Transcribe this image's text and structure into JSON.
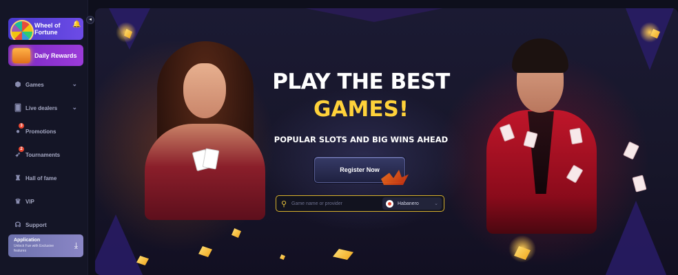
{
  "sidebar": {
    "wheel_label": "Wheel of Fortune",
    "daily_label": "Daily Rewards",
    "collapse_icon": "◂",
    "items": [
      {
        "label": "Games",
        "icon": "cube-icon",
        "has_chevron": true
      },
      {
        "label": "Live dealers",
        "icon": "cards-icon",
        "has_chevron": true
      },
      {
        "label": "Promotions",
        "icon": "bomb-icon",
        "badge": "3"
      },
      {
        "label": "Tournaments",
        "icon": "rocket-icon",
        "badge": "2"
      },
      {
        "label": "Hall of fame",
        "icon": "trophy-icon"
      },
      {
        "label": "VIP",
        "icon": "crown-icon"
      },
      {
        "label": "Support",
        "icon": "headset-icon"
      }
    ],
    "app_card": {
      "title": "Application",
      "subtitle": "Unlock Fun with Exclusive features"
    }
  },
  "banner": {
    "headline_line1": "PLAY THE BEST",
    "headline_line2": "GAMES!",
    "subheadline": "POPULAR SLOTS AND BIG WINS AHEAD",
    "register_label": "Register Now",
    "search": {
      "placeholder": "Game name or provider",
      "provider_selected": "Habanero"
    }
  },
  "colors": {
    "accent_yellow": "#ffd23a",
    "sidebar_bg": "#141526",
    "page_bg": "#0e0f1c"
  }
}
